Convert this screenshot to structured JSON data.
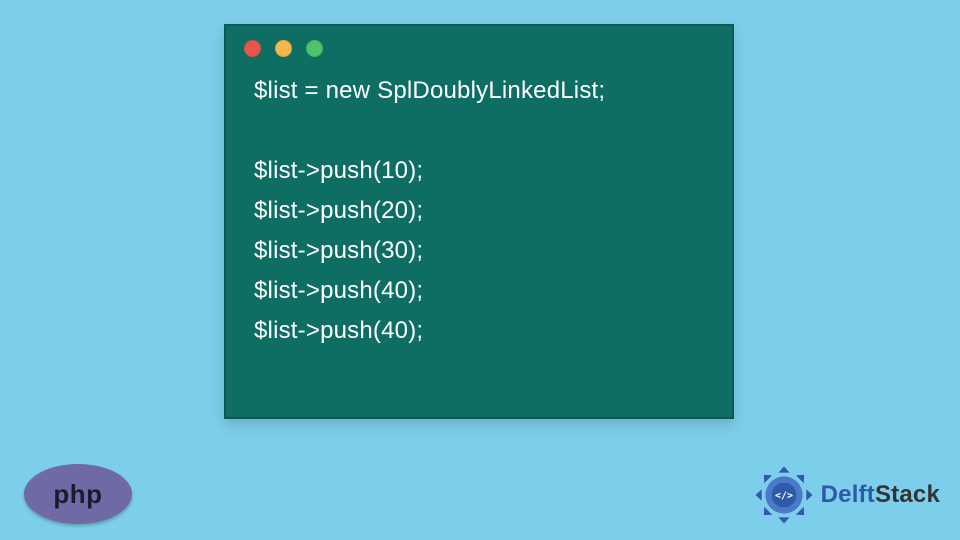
{
  "colors": {
    "background": "#7dceeb",
    "window_bg": "#0e6e64",
    "window_border": "#0a5a52",
    "dot_red": "#e8554d",
    "dot_yellow": "#f2b84b",
    "dot_green": "#4fc36a",
    "php_bg": "#6f6aa6",
    "php_text": "#1b1b2e",
    "delft_accent": "#2f5aa8"
  },
  "window": {
    "dots": [
      "close",
      "minimize",
      "maximize"
    ]
  },
  "code": {
    "lines": [
      "$list = new SplDoublyLinkedList;",
      "",
      "$list->push(10);",
      "$list->push(20);",
      "$list->push(30);",
      "$list->push(40);",
      "$list->push(40);"
    ]
  },
  "php_badge": {
    "label": "php"
  },
  "delft_badge": {
    "part1": "Delft",
    "part2": "Stack"
  }
}
